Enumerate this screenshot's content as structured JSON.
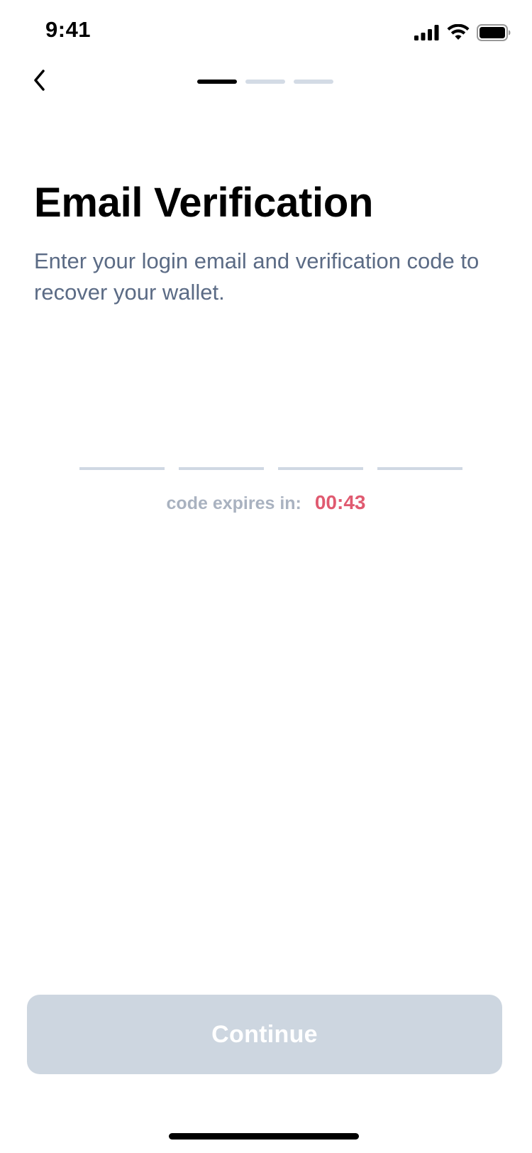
{
  "status_bar": {
    "time": "9:41",
    "icons": [
      "cellular-signal-icon",
      "wifi-icon",
      "battery-icon"
    ]
  },
  "nav": {
    "back_icon": "chevron-left-icon",
    "progress": {
      "total_steps": 3,
      "current_step": 1
    }
  },
  "page": {
    "title": "Email Verification",
    "subtitle": "Enter your login email and verification code to recover your wallet."
  },
  "code_inputs": {
    "count": 4,
    "values": [
      "",
      "",
      "",
      ""
    ]
  },
  "expiry": {
    "label": "code expires in:",
    "time": "00:43"
  },
  "continue_button": {
    "label": "Continue",
    "enabled": false
  },
  "colors": {
    "accent_danger": "#e05a70",
    "subtitle_text": "#5b6b85",
    "disabled_button": "#cdd6e0",
    "inactive_step": "#d3dbe5",
    "active_step": "#000000"
  }
}
